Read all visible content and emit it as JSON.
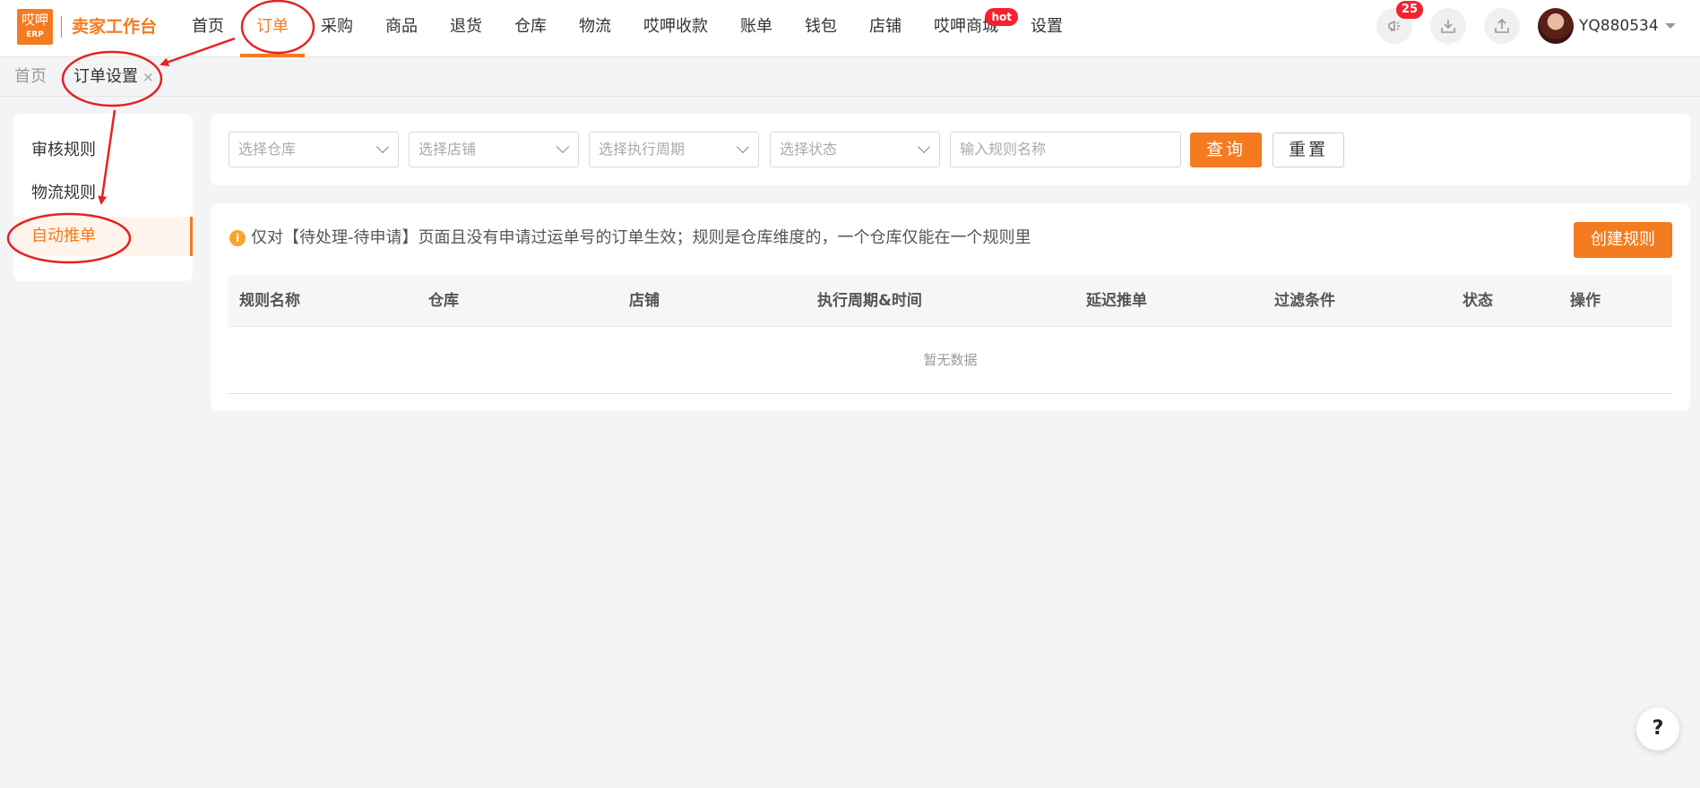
{
  "header": {
    "logo_line1": "哎呷",
    "logo_line2": "ERP",
    "app_title": "卖家工作台",
    "nav": [
      {
        "label": "首页"
      },
      {
        "label": "订单"
      },
      {
        "label": "采购"
      },
      {
        "label": "商品"
      },
      {
        "label": "退货"
      },
      {
        "label": "仓库"
      },
      {
        "label": "物流"
      },
      {
        "label": "哎呷收款"
      },
      {
        "label": "账单"
      },
      {
        "label": "钱包"
      },
      {
        "label": "店铺"
      },
      {
        "label": "哎呷商城",
        "badge": "hot"
      },
      {
        "label": "设置"
      }
    ],
    "active_nav": "订单",
    "notification_count": "25",
    "username": "YQ880534",
    "accent_color": "#f47b20"
  },
  "tabs": {
    "home": "首页",
    "active": "订单设置",
    "close_glyph": "×"
  },
  "sidebar": {
    "items": [
      {
        "label": "审核规则"
      },
      {
        "label": "物流规则"
      },
      {
        "label": "自动推单"
      }
    ],
    "active": "自动推单"
  },
  "filters": {
    "warehouse_placeholder": "选择仓库",
    "store_placeholder": "选择店铺",
    "period_placeholder": "选择执行周期",
    "status_placeholder": "选择状态",
    "rule_name_placeholder": "输入规则名称",
    "query_label": "查询",
    "reset_label": "重置"
  },
  "main": {
    "notice": "仅对【待处理-待申请】页面且没有申请过运单号的订单生效；规则是仓库维度的，一个仓库仅能在一个规则里",
    "create_label": "创建规则",
    "table": {
      "columns": [
        "规则名称",
        "仓库",
        "店铺",
        "执行周期&时间",
        "延迟推单",
        "过滤条件",
        "状态",
        "操作"
      ],
      "empty_text": "暂无数据"
    }
  },
  "help_label": "?"
}
